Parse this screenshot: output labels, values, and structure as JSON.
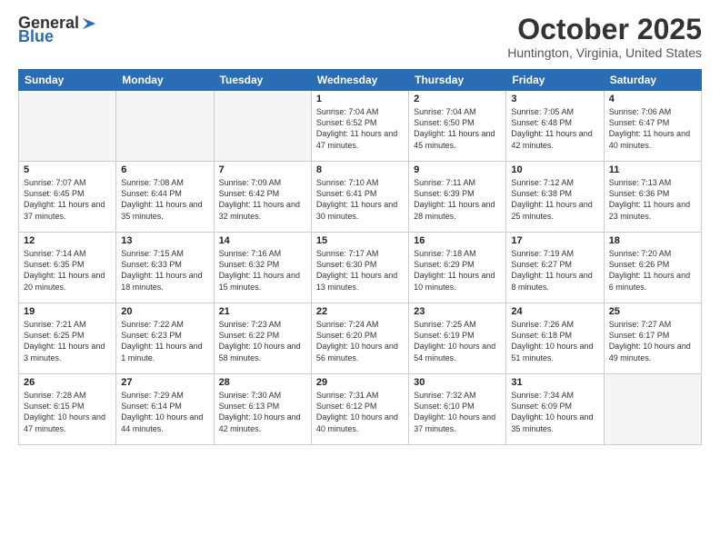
{
  "header": {
    "logo_general": "General",
    "logo_blue": "Blue",
    "title": "October 2025",
    "location": "Huntington, Virginia, United States"
  },
  "days_of_week": [
    "Sunday",
    "Monday",
    "Tuesday",
    "Wednesday",
    "Thursday",
    "Friday",
    "Saturday"
  ],
  "weeks": [
    [
      {
        "day": "",
        "empty": true
      },
      {
        "day": "",
        "empty": true
      },
      {
        "day": "",
        "empty": true
      },
      {
        "day": "1",
        "sunrise": "7:04 AM",
        "sunset": "6:52 PM",
        "daylight": "11 hours and 47 minutes."
      },
      {
        "day": "2",
        "sunrise": "7:04 AM",
        "sunset": "6:50 PM",
        "daylight": "11 hours and 45 minutes."
      },
      {
        "day": "3",
        "sunrise": "7:05 AM",
        "sunset": "6:48 PM",
        "daylight": "11 hours and 42 minutes."
      },
      {
        "day": "4",
        "sunrise": "7:06 AM",
        "sunset": "6:47 PM",
        "daylight": "11 hours and 40 minutes."
      }
    ],
    [
      {
        "day": "5",
        "sunrise": "7:07 AM",
        "sunset": "6:45 PM",
        "daylight": "11 hours and 37 minutes."
      },
      {
        "day": "6",
        "sunrise": "7:08 AM",
        "sunset": "6:44 PM",
        "daylight": "11 hours and 35 minutes."
      },
      {
        "day": "7",
        "sunrise": "7:09 AM",
        "sunset": "6:42 PM",
        "daylight": "11 hours and 32 minutes."
      },
      {
        "day": "8",
        "sunrise": "7:10 AM",
        "sunset": "6:41 PM",
        "daylight": "11 hours and 30 minutes."
      },
      {
        "day": "9",
        "sunrise": "7:11 AM",
        "sunset": "6:39 PM",
        "daylight": "11 hours and 28 minutes."
      },
      {
        "day": "10",
        "sunrise": "7:12 AM",
        "sunset": "6:38 PM",
        "daylight": "11 hours and 25 minutes."
      },
      {
        "day": "11",
        "sunrise": "7:13 AM",
        "sunset": "6:36 PM",
        "daylight": "11 hours and 23 minutes."
      }
    ],
    [
      {
        "day": "12",
        "sunrise": "7:14 AM",
        "sunset": "6:35 PM",
        "daylight": "11 hours and 20 minutes."
      },
      {
        "day": "13",
        "sunrise": "7:15 AM",
        "sunset": "6:33 PM",
        "daylight": "11 hours and 18 minutes."
      },
      {
        "day": "14",
        "sunrise": "7:16 AM",
        "sunset": "6:32 PM",
        "daylight": "11 hours and 15 minutes."
      },
      {
        "day": "15",
        "sunrise": "7:17 AM",
        "sunset": "6:30 PM",
        "daylight": "11 hours and 13 minutes."
      },
      {
        "day": "16",
        "sunrise": "7:18 AM",
        "sunset": "6:29 PM",
        "daylight": "11 hours and 10 minutes."
      },
      {
        "day": "17",
        "sunrise": "7:19 AM",
        "sunset": "6:27 PM",
        "daylight": "11 hours and 8 minutes."
      },
      {
        "day": "18",
        "sunrise": "7:20 AM",
        "sunset": "6:26 PM",
        "daylight": "11 hours and 6 minutes."
      }
    ],
    [
      {
        "day": "19",
        "sunrise": "7:21 AM",
        "sunset": "6:25 PM",
        "daylight": "11 hours and 3 minutes."
      },
      {
        "day": "20",
        "sunrise": "7:22 AM",
        "sunset": "6:23 PM",
        "daylight": "11 hours and 1 minute."
      },
      {
        "day": "21",
        "sunrise": "7:23 AM",
        "sunset": "6:22 PM",
        "daylight": "10 hours and 58 minutes."
      },
      {
        "day": "22",
        "sunrise": "7:24 AM",
        "sunset": "6:20 PM",
        "daylight": "10 hours and 56 minutes."
      },
      {
        "day": "23",
        "sunrise": "7:25 AM",
        "sunset": "6:19 PM",
        "daylight": "10 hours and 54 minutes."
      },
      {
        "day": "24",
        "sunrise": "7:26 AM",
        "sunset": "6:18 PM",
        "daylight": "10 hours and 51 minutes."
      },
      {
        "day": "25",
        "sunrise": "7:27 AM",
        "sunset": "6:17 PM",
        "daylight": "10 hours and 49 minutes."
      }
    ],
    [
      {
        "day": "26",
        "sunrise": "7:28 AM",
        "sunset": "6:15 PM",
        "daylight": "10 hours and 47 minutes."
      },
      {
        "day": "27",
        "sunrise": "7:29 AM",
        "sunset": "6:14 PM",
        "daylight": "10 hours and 44 minutes."
      },
      {
        "day": "28",
        "sunrise": "7:30 AM",
        "sunset": "6:13 PM",
        "daylight": "10 hours and 42 minutes."
      },
      {
        "day": "29",
        "sunrise": "7:31 AM",
        "sunset": "6:12 PM",
        "daylight": "10 hours and 40 minutes."
      },
      {
        "day": "30",
        "sunrise": "7:32 AM",
        "sunset": "6:10 PM",
        "daylight": "10 hours and 37 minutes."
      },
      {
        "day": "31",
        "sunrise": "7:34 AM",
        "sunset": "6:09 PM",
        "daylight": "10 hours and 35 minutes."
      },
      {
        "day": "",
        "empty": true
      }
    ]
  ]
}
